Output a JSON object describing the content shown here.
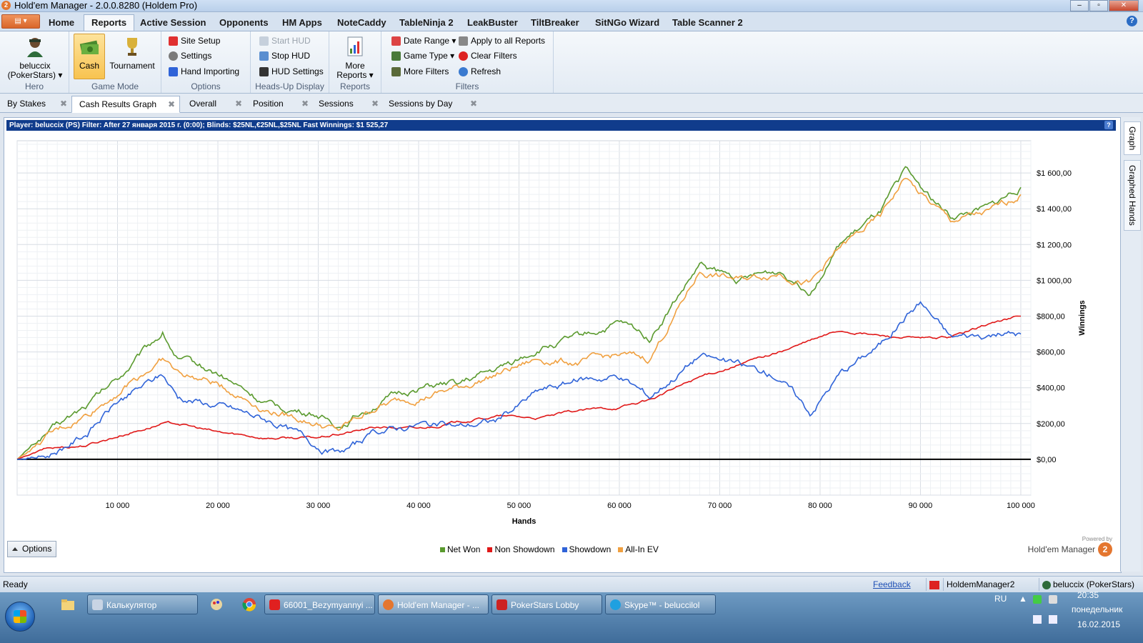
{
  "window": {
    "title": "Hold'em Manager - 2.0.0.8280 (Holdem Pro)"
  },
  "menu_tabs": [
    "Home",
    "Reports",
    "Active Session",
    "Opponents",
    "HM Apps",
    "NoteCaddy",
    "TableNinja 2",
    "LeakBuster",
    "TiltBreaker",
    "SitNGo Wizard",
    "Table Scanner 2"
  ],
  "ribbon": {
    "hero": {
      "name_line1": "beluccix",
      "name_line2": "(PokerStars)",
      "label": "Hero"
    },
    "game_mode": {
      "cash": "Cash",
      "tournament": "Tournament",
      "label": "Game Mode"
    },
    "options": {
      "site_setup": "Site Setup",
      "settings": "Settings",
      "hand_importing": "Hand Importing",
      "label": "Options"
    },
    "hud": {
      "start": "Start HUD",
      "stop": "Stop HUD",
      "settings": "HUD Settings",
      "label": "Heads-Up Display"
    },
    "reports": {
      "more_line1": "More",
      "more_line2": "Reports",
      "label": "Reports"
    },
    "filters": {
      "date_range": "Date Range",
      "game_type": "Game Type",
      "more_filters": "More Filters",
      "apply_all": "Apply to all Reports",
      "clear": "Clear Filters",
      "refresh": "Refresh",
      "label": "Filters"
    }
  },
  "report_tabs": [
    "By Stakes",
    "Cash Results Graph",
    "Overall",
    "Position",
    "Sessions",
    "Sessions by Day"
  ],
  "infobar": "Player:  beluccix (PS)  Filter:  After 27 января 2015 г. (0:00); Blinds: $25NL,€25NL,$25NL Fast  Winnings:  $1 525,27",
  "side_tabs": [
    "Graph",
    "Graphed Hands"
  ],
  "options_label": "Options",
  "powered_by": "Powered by",
  "brand": "Hold'em Manager",
  "status": {
    "ready": "Ready",
    "feedback": "Feedback",
    "hm2": "HoldemManager2",
    "player": "beluccix (PokerStars)"
  },
  "taskbar": {
    "tasks": [
      "Калькулятор",
      "66001_Bezymyannyi ...",
      "Hold'em Manager - ...",
      "PokerStars Lobby",
      "Skype™ - beluccilol"
    ],
    "lang": "RU",
    "time": "20:35",
    "day": "понедельник",
    "date": "16.02.2015"
  },
  "colors": {
    "net_won": "#5a9a2e",
    "non_showdown": "#e01818",
    "showdown": "#2f63d8",
    "allin_ev": "#f0a040"
  },
  "chart_data": {
    "type": "line",
    "xlabel": "Hands",
    "ylabel": "Winnings",
    "xlim": [
      0,
      101000
    ],
    "ylim": [
      -200,
      1780
    ],
    "x_ticks": [
      10000,
      20000,
      30000,
      40000,
      50000,
      60000,
      70000,
      80000,
      90000,
      100000
    ],
    "x_tick_labels": [
      "10 000",
      "20 000",
      "30 000",
      "40 000",
      "50 000",
      "60 000",
      "70 000",
      "80 000",
      "90 000",
      "100 000"
    ],
    "y_ticks": [
      0,
      200,
      400,
      600,
      800,
      1000,
      1200,
      1400,
      1600
    ],
    "y_tick_labels": [
      "$0,00",
      "$200,00",
      "$400,00",
      "$600,00",
      "$800,00",
      "$1 000,00",
      "$1 200,00",
      "$1 400,00",
      "$1 600,00"
    ],
    "grid": true,
    "legend_position": "bottom",
    "x": [
      0,
      3000,
      7000,
      10000,
      14500,
      16000,
      20000,
      25000,
      30000,
      32000,
      36000,
      40000,
      44000,
      48000,
      52000,
      56000,
      60000,
      63000,
      68000,
      72000,
      76000,
      79000,
      82000,
      86000,
      88500,
      90000,
      93000,
      97000,
      100000
    ],
    "series": [
      {
        "name": "Net Won",
        "values": [
          0,
          150,
          300,
          450,
          710,
          560,
          480,
          300,
          250,
          190,
          320,
          400,
          420,
          500,
          620,
          680,
          760,
          680,
          1080,
          1000,
          1050,
          950,
          1200,
          1370,
          1600,
          1520,
          1350,
          1400,
          1520
        ]
      },
      {
        "name": "Non Showdown",
        "values": [
          0,
          60,
          80,
          130,
          200,
          200,
          150,
          120,
          120,
          140,
          180,
          170,
          210,
          240,
          230,
          270,
          290,
          330,
          460,
          530,
          600,
          660,
          720,
          690,
          680,
          670,
          680,
          760,
          800
        ]
      },
      {
        "name": "Showdown",
        "values": [
          0,
          20,
          150,
          320,
          470,
          350,
          300,
          220,
          80,
          30,
          150,
          200,
          180,
          220,
          380,
          440,
          470,
          350,
          580,
          520,
          460,
          260,
          480,
          640,
          800,
          880,
          680,
          700,
          700
        ]
      },
      {
        "name": "All-In EV",
        "values": [
          0,
          120,
          250,
          380,
          560,
          480,
          420,
          280,
          200,
          160,
          300,
          350,
          400,
          480,
          560,
          540,
          580,
          560,
          1050,
          1000,
          1050,
          980,
          1180,
          1350,
          1580,
          1480,
          1330,
          1380,
          1480
        ]
      }
    ]
  }
}
